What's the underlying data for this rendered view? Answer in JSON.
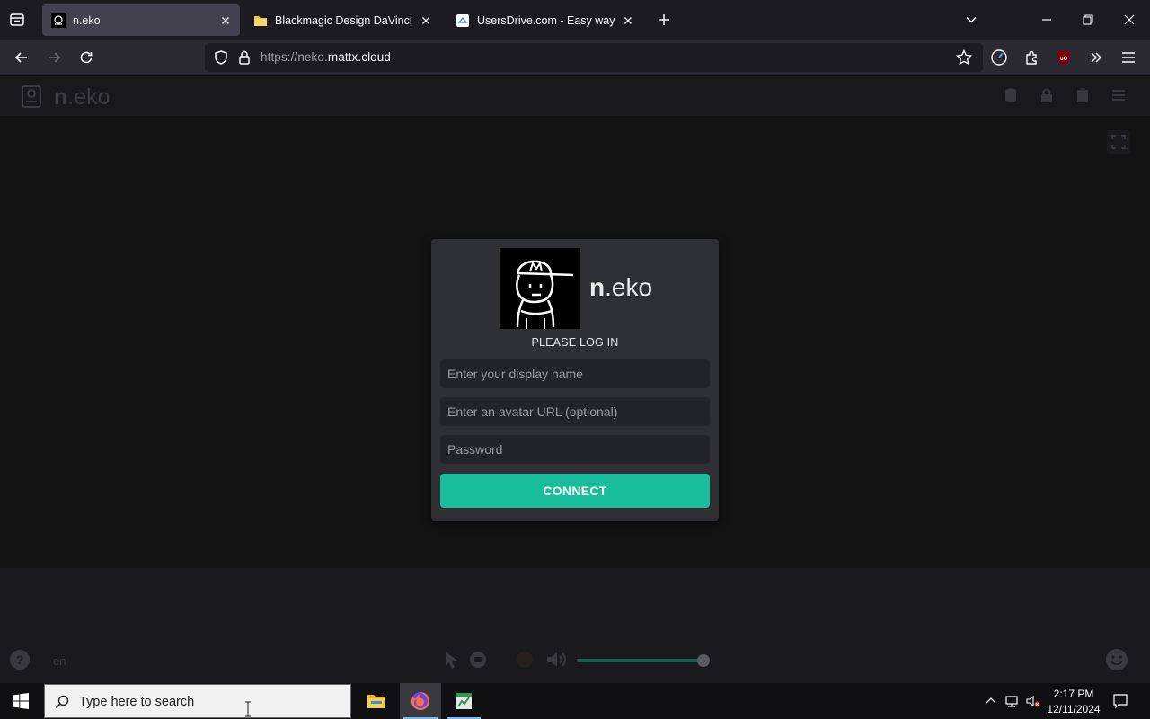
{
  "browser": {
    "tabs": [
      {
        "title": "n.eko",
        "active": true
      },
      {
        "title": "Blackmagic Design DaVinci Res",
        "active": false
      },
      {
        "title": "UsersDrive.com - Easy way to s",
        "active": false
      }
    ],
    "url_prefix": "https://neko.",
    "url_host": "mattx.cloud"
  },
  "neko": {
    "brand_bold": "n",
    "brand_rest": ".eko",
    "login": {
      "heading": "PLEASE LOG IN",
      "display_name_placeholder": "Enter your display name",
      "avatar_placeholder": "Enter an avatar URL (optional)",
      "password_placeholder": "Password",
      "connect_label": "CONNECT"
    },
    "controls": {
      "language": "en",
      "volume_level": 0.99
    }
  },
  "taskbar": {
    "search_placeholder": "Type here to search",
    "time": "2:17 PM",
    "date": "12/11/2024"
  },
  "colors": {
    "accent": "#19bd9c",
    "card": "#2f3034",
    "tab_active": "#42414d"
  }
}
